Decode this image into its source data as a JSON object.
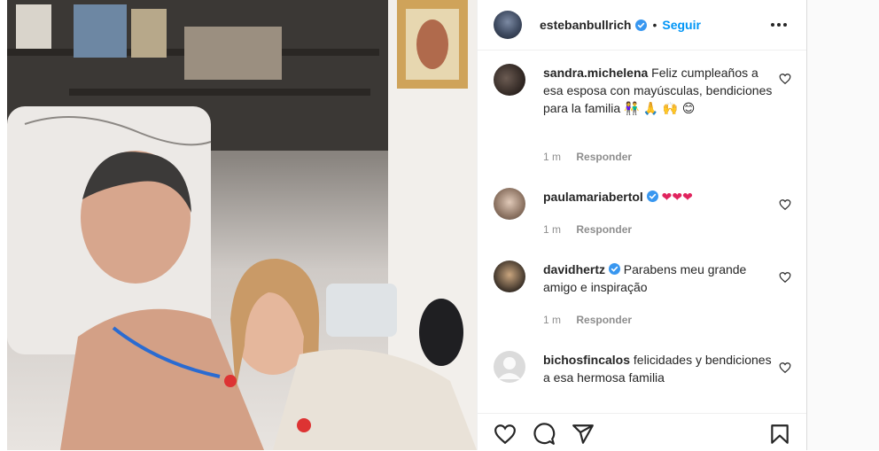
{
  "post": {
    "author": "estebanbullrich",
    "separator": "•",
    "follow_label": "Seguir"
  },
  "comments": [
    {
      "username": "sandra.michelena",
      "text": "Feliz cumpleaños a esa esposa con mayúsculas, bendiciones para la familia",
      "emojis": "👫 🙏 🙌 😊",
      "time": "1 m",
      "reply": "Responder"
    },
    {
      "username": "paulamariabertol",
      "verified": true,
      "text": "",
      "emojis": "❤❤❤",
      "time": "1 m",
      "reply": "Responder"
    },
    {
      "username": "davidhertz",
      "verified": true,
      "text": "Parabens meu grande amigo e inspiração",
      "time": "1 m",
      "reply": "Responder"
    },
    {
      "username": "bichosfincalos",
      "text": "felicidades y bendiciones a esa hermosa familia"
    }
  ],
  "icons": [
    "verified-badge-icon",
    "more-options-icon",
    "heart-icon",
    "comment-icon",
    "share-icon",
    "bookmark-icon"
  ],
  "colors": {
    "link": "#0095f6",
    "verified": "#3897f0",
    "text": "#262626",
    "muted": "#8e8e8e",
    "heart": "#ed4956"
  }
}
